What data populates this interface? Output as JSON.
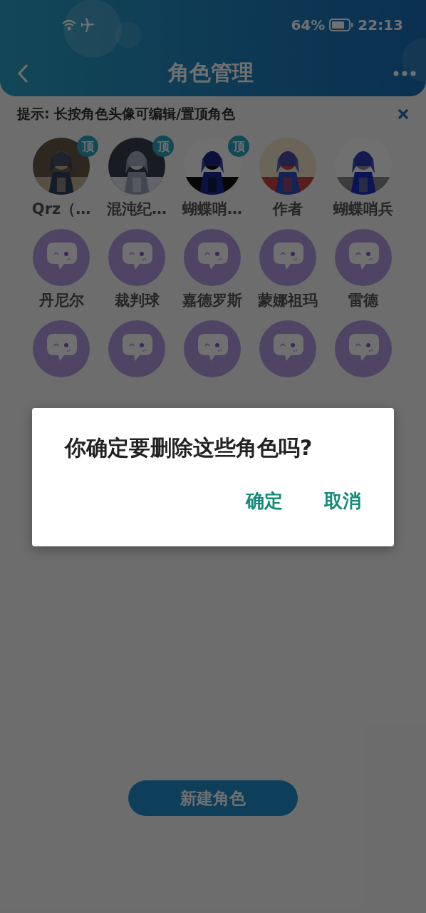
{
  "status_bar": {
    "battery_text": "64%",
    "time": "22:13"
  },
  "header": {
    "title": "角色管理"
  },
  "tip": {
    "text": "提示: 长按角色头像可编辑/置顶角色"
  },
  "characters": [
    {
      "name": "Qrz（…",
      "kind": "picture",
      "pinned": true,
      "pin_label": "顶"
    },
    {
      "name": "混沌纪…",
      "kind": "picture",
      "pinned": true,
      "pin_label": "顶"
    },
    {
      "name": "蝴蝶哨…",
      "kind": "picture",
      "pinned": true,
      "pin_label": "顶"
    },
    {
      "name": "作者",
      "kind": "picture",
      "pinned": false
    },
    {
      "name": "蝴蝶哨兵",
      "kind": "picture",
      "pinned": false
    },
    {
      "name": "丹尼尔",
      "kind": "default",
      "pinned": false
    },
    {
      "name": "裁判球",
      "kind": "default",
      "pinned": false
    },
    {
      "name": "嘉德罗斯",
      "kind": "default",
      "pinned": false
    },
    {
      "name": "蒙娜祖玛",
      "kind": "default",
      "pinned": false
    },
    {
      "name": "雷德",
      "kind": "default",
      "pinned": false
    },
    {
      "kind": "default",
      "pinned": false
    },
    {
      "kind": "default",
      "pinned": false
    },
    {
      "kind": "default",
      "pinned": false
    },
    {
      "kind": "default",
      "pinned": false
    },
    {
      "kind": "default",
      "pinned": false
    }
  ],
  "new_button": {
    "label": "新建角色"
  },
  "dialog": {
    "message": "你确定要删除这些角色吗?",
    "buttons": [
      "确定",
      "取消"
    ]
  }
}
